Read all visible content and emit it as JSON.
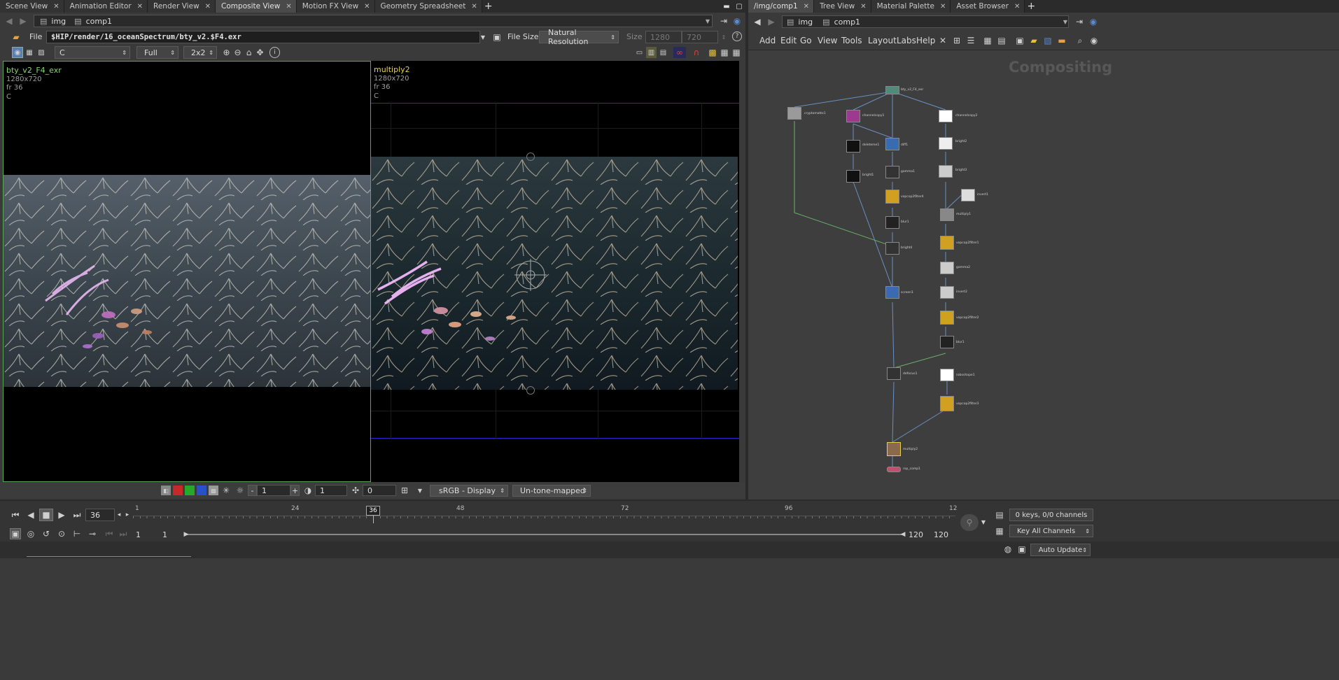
{
  "left_tabs": [
    {
      "label": "Scene View",
      "active": false
    },
    {
      "label": "Animation Editor",
      "active": false
    },
    {
      "label": "Render View",
      "active": false
    },
    {
      "label": "Composite View",
      "active": true
    },
    {
      "label": "Motion FX View",
      "active": false
    },
    {
      "label": "Geometry Spreadsheet",
      "active": false
    }
  ],
  "right_tabs": [
    {
      "label": "/img/comp1",
      "active": true
    },
    {
      "label": "Tree View",
      "active": false
    },
    {
      "label": "Material Palette",
      "active": false
    },
    {
      "label": "Asset Browser",
      "active": false
    }
  ],
  "left_path": {
    "net": "img",
    "node": "comp1"
  },
  "right_path": {
    "net": "img",
    "node": "comp1"
  },
  "file_toolbar": {
    "file_label": "File",
    "file_path": "$HIP/render/16_oceanSpectrum/bty_v2.$F4.exr",
    "file_size_label": "File Size",
    "resolution_option": "Natural Resolution",
    "size_label": "Size",
    "size_w": "1280",
    "size_h": "720"
  },
  "view_toolbar": {
    "channel": "C",
    "resolution": "Full",
    "proxy": "2x2"
  },
  "viewer_left": {
    "name": "bty_v2_F4_exr",
    "res": "1280x720",
    "frame": "fr 36",
    "plane": "C"
  },
  "viewer_right": {
    "name": "multiply2",
    "res": "1280x720",
    "frame": "fr 36",
    "plane": "C"
  },
  "bottom_toolbar": {
    "exposure_value": "1",
    "gamma_value": "1",
    "offset_value": "0",
    "display_lut": "sRGB - Display",
    "tonemap": "Un-tone-mapped",
    "minus": "-",
    "plus": "+"
  },
  "network": {
    "context_label": "Compositing",
    "menu": [
      "Add",
      "Edit",
      "Go",
      "View",
      "Tools",
      "Layout",
      "Labs",
      "Help"
    ],
    "nodes": [
      {
        "label": "bty_v2_F4_exr",
        "color": "#4f8a7a"
      },
      {
        "label": "cryptomatte1",
        "color": "#9a9a9a"
      },
      {
        "label": "channelcopy1",
        "color": "#9b3a8f"
      },
      {
        "label": "channelcopy2",
        "color": "#9b3a8f"
      },
      {
        "label": "deleteme1",
        "color": "#6a6a6a"
      },
      {
        "label": "diff1",
        "color": "#3a6ab0"
      },
      {
        "label": "bright2",
        "color": "#6a6a6a"
      },
      {
        "label": "bright1",
        "color": "#6a6a6a"
      },
      {
        "label": "gamma1",
        "color": "#6a6a6a"
      },
      {
        "label": "bright3",
        "color": "#6a6a6a"
      },
      {
        "label": "invert1",
        "color": "#6a6a6a"
      },
      {
        "label": "vopcop2filter4",
        "color": "#d1a020"
      },
      {
        "label": "multiply1",
        "color": "#6a6a6a"
      },
      {
        "label": "blur1",
        "color": "#6a6a6a"
      },
      {
        "label": "vopcop2filter1",
        "color": "#d1a020"
      },
      {
        "label": "bright4",
        "color": "#6a6a6a"
      },
      {
        "label": "gamma2",
        "color": "#6a6a6a"
      },
      {
        "label": "screen1",
        "color": "#3a6ab0"
      },
      {
        "label": "invert2",
        "color": "#6a6a6a"
      },
      {
        "label": "vopcop2filter2",
        "color": "#d1a020"
      },
      {
        "label": "blur1",
        "color": "#6a6a6a"
      },
      {
        "label": "defocus1",
        "color": "#6a6a6a"
      },
      {
        "label": "roboshape1",
        "color": "#6a8a6a"
      },
      {
        "label": "vopcop2filter3",
        "color": "#d1a020"
      },
      {
        "label": "multiply2",
        "color": "#8a6a4a"
      },
      {
        "label": "rop_comp1",
        "color": "#c05070"
      }
    ]
  },
  "timeline": {
    "current_frame": "36",
    "ticks": [
      "1",
      "24",
      "48",
      "72",
      "96",
      "12"
    ],
    "start": "1",
    "start2": "1",
    "end": "120",
    "end2": "120",
    "keys_info": "0 keys, 0/0 channels",
    "key_mode": "Key All Channels",
    "auto_update": "Auto Update"
  },
  "colors": {
    "accent_green": "#86d46c",
    "accent_yellow": "#e6d24a",
    "roi_blue": "#2a2ad0"
  }
}
